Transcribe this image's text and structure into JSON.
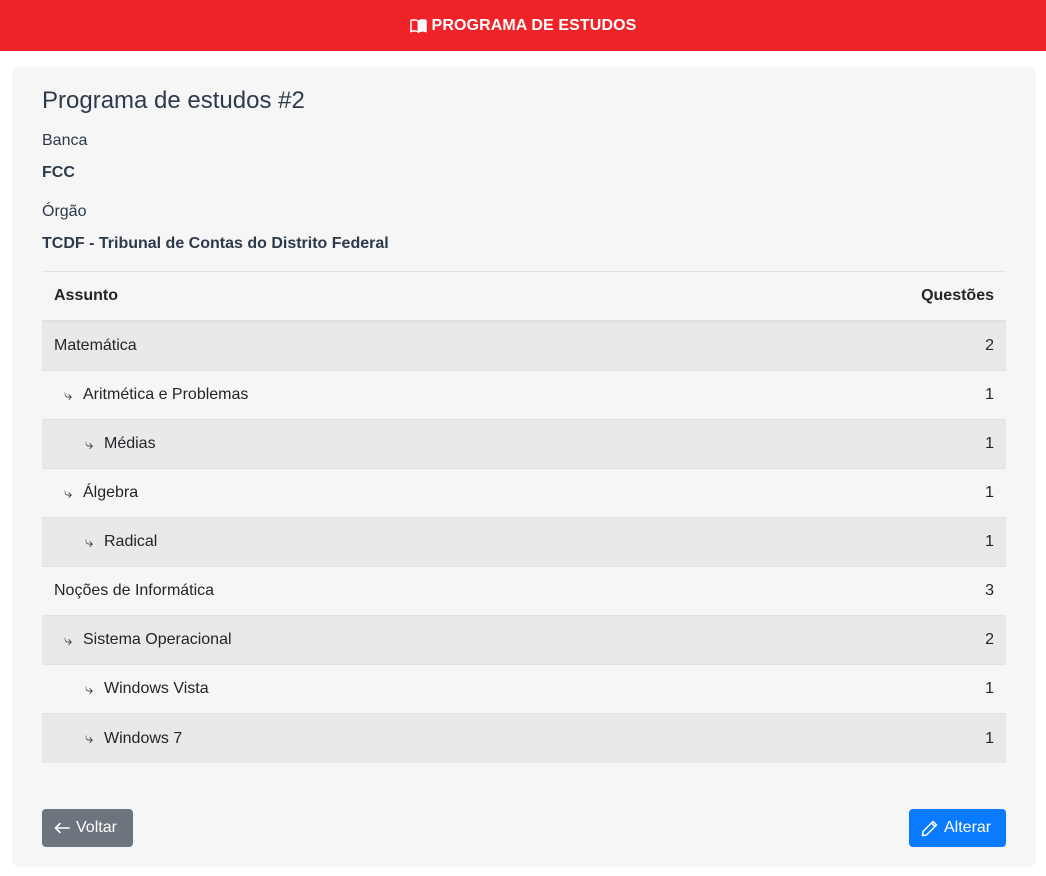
{
  "header": {
    "title": "PROGRAMA DE ESTUDOS",
    "icon": "book-icon",
    "background": "#ef2328"
  },
  "program": {
    "title": "Programa de estudos #2",
    "banca_label": "Banca",
    "banca_value": "FCC",
    "orgao_label": "Órgão",
    "orgao_value": "TCDF - Tribunal de Contas do Distrito Federal"
  },
  "table": {
    "col_subject": "Assunto",
    "col_questions": "Questões",
    "rows": [
      {
        "label": "Matemática",
        "count": "2",
        "level": 0
      },
      {
        "label": "Aritmética e Problemas",
        "count": "1",
        "level": 1
      },
      {
        "label": "Médias",
        "count": "1",
        "level": 2
      },
      {
        "label": "Álgebra",
        "count": "1",
        "level": 1
      },
      {
        "label": "Radical",
        "count": "1",
        "level": 2
      },
      {
        "label": "Noções de Informática",
        "count": "3",
        "level": 0
      },
      {
        "label": "Sistema Operacional",
        "count": "2",
        "level": 1
      },
      {
        "label": "Windows Vista",
        "count": "1",
        "level": 2
      },
      {
        "label": "Windows 7",
        "count": "1",
        "level": 2
      }
    ],
    "child_arrow": "⤷"
  },
  "actions": {
    "back_label": "Voltar",
    "back_icon": "arrow-left-icon",
    "edit_label": "Alterar",
    "edit_icon": "pencil-icon",
    "back_color": "#6c757d",
    "edit_color": "#0a7bff"
  }
}
